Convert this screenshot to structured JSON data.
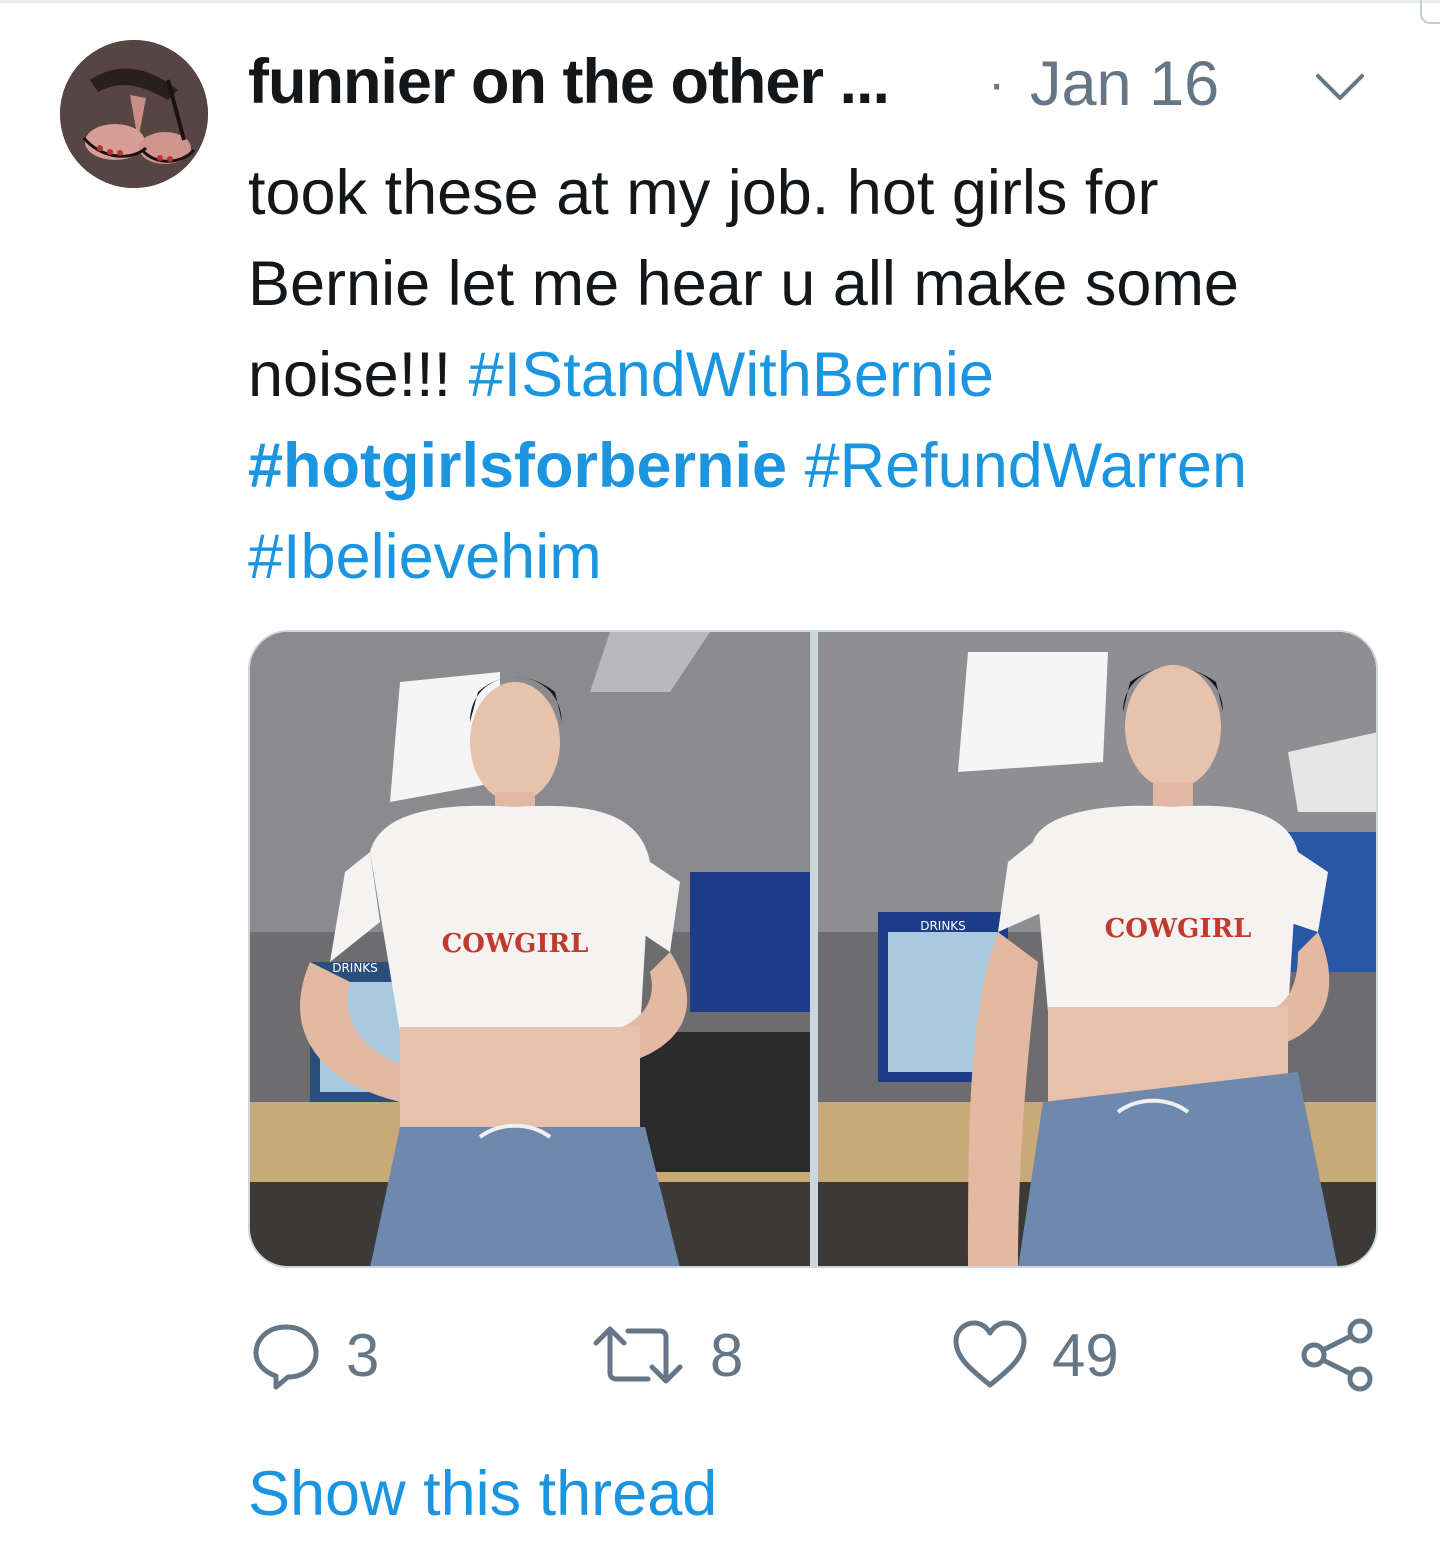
{
  "tweet": {
    "author": {
      "display_name": "funnier on the other ...",
      "avatar_icon": "avatar-photo"
    },
    "separator": "·",
    "timestamp": "Jan 16",
    "menu_icon": "chevron-down-icon",
    "text": {
      "line1": "took these at my job. hot girls for",
      "line2": "Bernie let me hear u all make some",
      "line3_prefix": "noise!!!",
      "hashtag1": "#IStandWithBernie",
      "hashtag2": "#hotgirlsforbernie",
      "hashtag3": "#RefundWarren",
      "hashtag4": "#Ibelievehim"
    },
    "photos": [
      {
        "shirt_text": "COWGIRL",
        "sign_text": "DRINKS"
      },
      {
        "shirt_text": "COWGIRL",
        "sign_text": "DRINKS"
      }
    ],
    "actions": {
      "reply_count": "3",
      "retweet_count": "8",
      "like_count": "49",
      "reply_icon": "reply-icon",
      "retweet_icon": "retweet-icon",
      "like_icon": "heart-icon",
      "share_icon": "share-icon"
    },
    "show_thread": "Show this thread"
  },
  "colors": {
    "link": "#1b95e0",
    "secondary_text": "#657786",
    "primary_text": "#14171a",
    "border": "#ccd6dd"
  }
}
